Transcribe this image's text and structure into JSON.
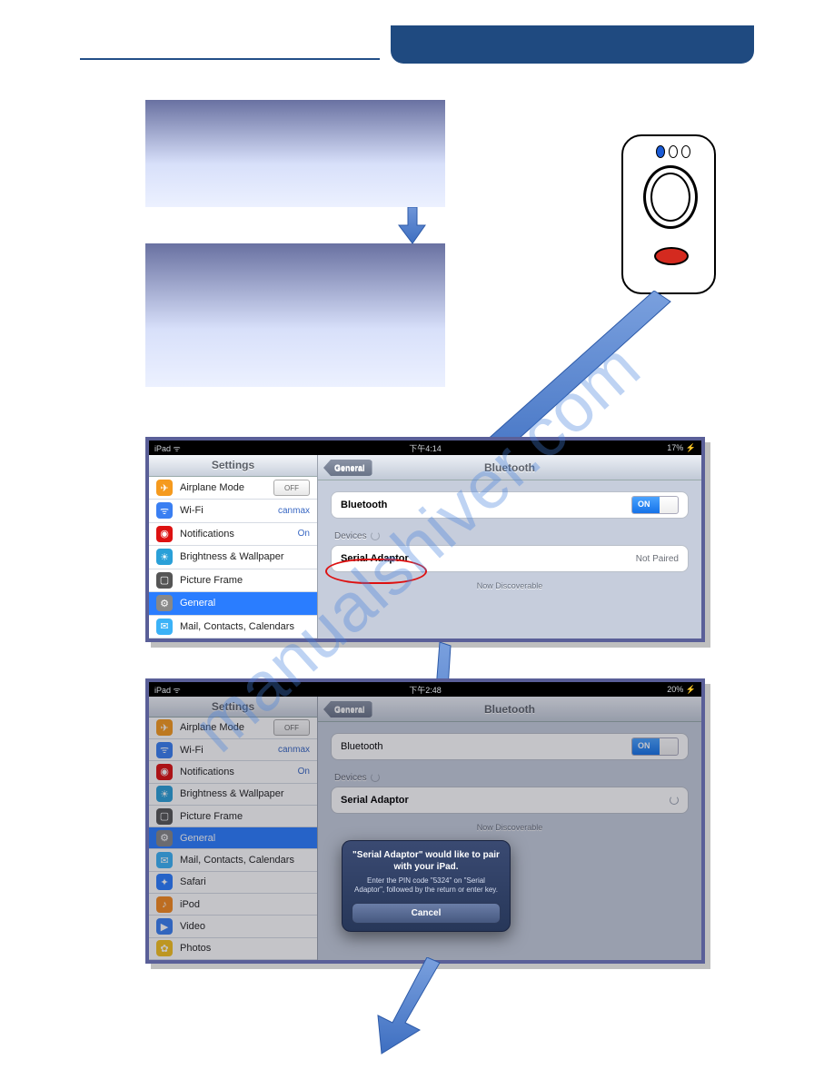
{
  "watermark": "manualshiver.com",
  "header": {},
  "device_diagram": {},
  "shot1": {
    "status": {
      "left": "iPad ᯤ",
      "center": "下午4:14",
      "right": "17% ⚡"
    },
    "sidebar": {
      "title": "Settings",
      "items": [
        {
          "label": "Airplane Mode",
          "value_off": "OFF"
        },
        {
          "label": "Wi-Fi",
          "value": "canmax"
        },
        {
          "label": "Notifications",
          "value": "On"
        },
        {
          "label": "Brightness & Wallpaper"
        },
        {
          "label": "Picture Frame"
        },
        {
          "label": "General",
          "selected": true
        },
        {
          "label": "Mail, Contacts, Calendars"
        }
      ]
    },
    "detail": {
      "back": "General",
      "title": "Bluetooth",
      "bluetooth_label": "Bluetooth",
      "toggle": "ON",
      "devices_label": "Devices",
      "device_row": {
        "name": "Serial Adaptor",
        "status": "Not Paired"
      },
      "discoverable": "Now Discoverable"
    }
  },
  "shot2": {
    "status": {
      "left": "iPad ᯤ",
      "center": "下午2:48",
      "right": "20% ⚡"
    },
    "sidebar": {
      "title": "Settings",
      "items": [
        {
          "label": "Airplane Mode",
          "value_off": "OFF"
        },
        {
          "label": "Wi-Fi",
          "value": "canmax"
        },
        {
          "label": "Notifications",
          "value": "On"
        },
        {
          "label": "Brightness & Wallpaper"
        },
        {
          "label": "Picture Frame"
        },
        {
          "label": "General",
          "selected": true
        },
        {
          "label": "Mail, Contacts, Calendars"
        },
        {
          "label": "Safari"
        },
        {
          "label": "iPod"
        },
        {
          "label": "Video"
        },
        {
          "label": "Photos"
        }
      ]
    },
    "detail": {
      "back": "General",
      "title": "Bluetooth",
      "bluetooth_label": "Bluetooth",
      "toggle": "ON",
      "devices_label": "Devices",
      "device_row": {
        "name": "Serial Adaptor",
        "status": ""
      },
      "discoverable": "Now Discoverable"
    },
    "dialog": {
      "title": "\"Serial Adaptor\" would like to pair with your iPad.",
      "body": "Enter the PIN code \"5324\" on \"Serial Adaptor\", followed by the return or enter key.",
      "cancel": "Cancel"
    }
  }
}
